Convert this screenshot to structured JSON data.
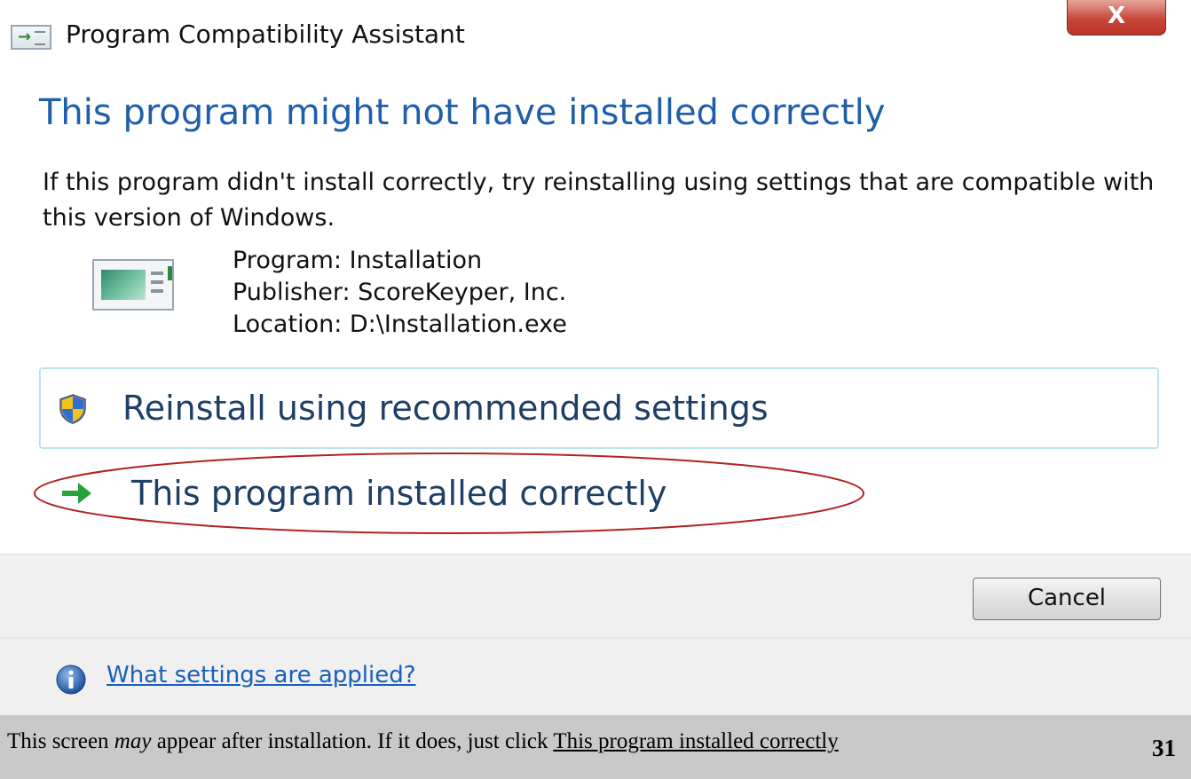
{
  "window": {
    "title": "Program Compatibility Assistant",
    "close_glyph": "X"
  },
  "main": {
    "heading": "This program might not have installed correctly",
    "description": "If this program didn't install correctly, try reinstalling using settings that are compatible with this version of Windows.",
    "program_line": "Program: Installation",
    "publisher_line": "Publisher: ScoreKeyper, Inc.",
    "location_line": "Location: D:\\Installation.exe"
  },
  "options": {
    "reinstall_label": "Reinstall using recommended settings",
    "installed_correctly_label": "This program installed correctly"
  },
  "buttons": {
    "cancel_label": "Cancel"
  },
  "footer": {
    "link_text": "What settings are applied?"
  },
  "caption": {
    "part1": "This screen ",
    "emphasis": "may",
    "part2": " appear after installation.  If it does, just click ",
    "underlined": "This program installed correctly",
    "page_number": "31"
  },
  "colors": {
    "heading_blue": "#1f5fa9",
    "option_text": "#1e3f66",
    "annotation_ellipse": "#b22222",
    "link_blue": "#1a5fb8",
    "caption_bg": "#c9c9c9"
  },
  "icons": {
    "title_icon": "compatibility-app-icon",
    "program_icon": "program-window-icon",
    "reinstall_icon": "uac-shield-icon",
    "correct_icon": "green-arrow-icon",
    "info_icon": "info-icon"
  }
}
